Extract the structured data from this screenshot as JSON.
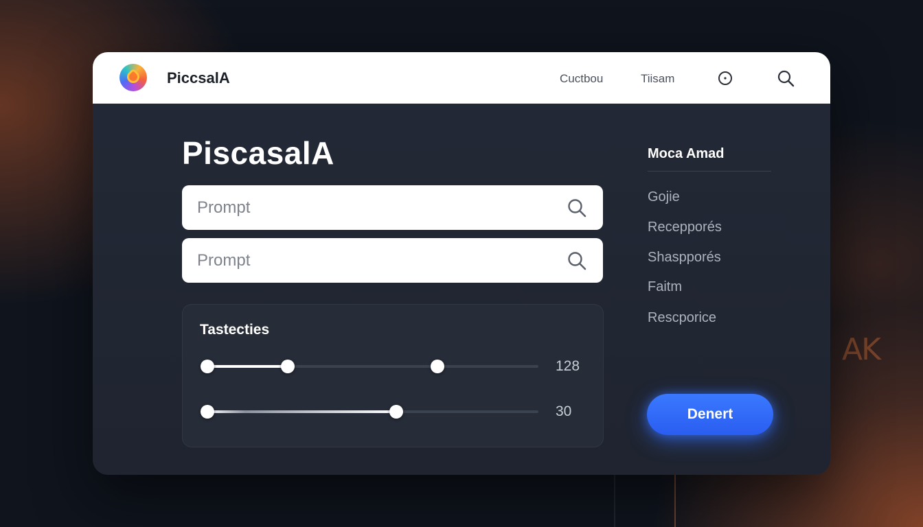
{
  "background": {
    "watermark": "AK"
  },
  "header": {
    "app_name": "PiccsalA",
    "nav": [
      "Cuctbou",
      "Tiisam"
    ],
    "icons": [
      "info-icon",
      "search-icon"
    ]
  },
  "main": {
    "title": "PiscasalA",
    "prompt_1": {
      "placeholder": "Prompt",
      "value": ""
    },
    "prompt_2": {
      "placeholder": "Prompt",
      "value": ""
    },
    "settings": {
      "title": "Tastecties",
      "slider_1": {
        "value": "128"
      },
      "slider_2": {
        "value": "30"
      }
    }
  },
  "sidebar": {
    "header": "Moca Amad",
    "items": [
      "Gojie",
      "Recepporés",
      "Shaspporés",
      "Faitm",
      "Rescporice"
    ],
    "button_label": "Denert"
  },
  "colors": {
    "accent": "#2f6bff",
    "panel": "#232936",
    "page_bg": "#0f141d"
  }
}
